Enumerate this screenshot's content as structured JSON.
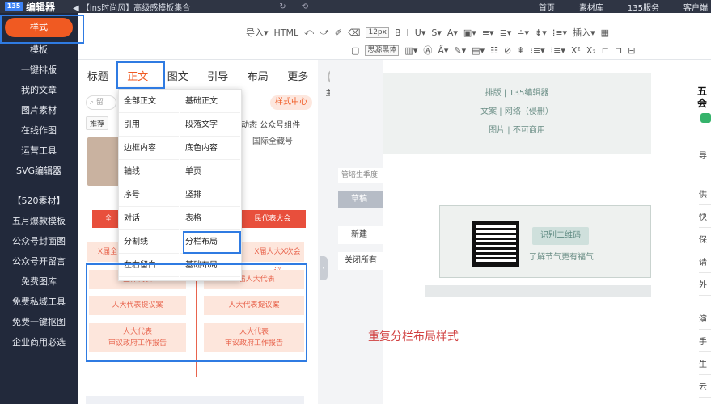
{
  "topbar": {
    "logo": "编辑器",
    "logo_badge": "135",
    "notice": "◀ 【ins时尚风】高级感模板集合",
    "tools": "↻ ⟲",
    "nav": [
      "首页",
      "素材库",
      "135服务",
      "客户端"
    ]
  },
  "sidebar": {
    "active": "样式",
    "items": [
      "模板",
      "一键排版",
      "我的文章",
      "图片素材",
      "在线作图",
      "运营工具",
      "SVG编辑器"
    ],
    "items2": [
      "【520素材】",
      "五月爆款模板",
      "公众号封面图",
      "公众号开留言",
      "免费图库",
      "免费私域工具",
      "免费一键抠图",
      "企业商用必选"
    ]
  },
  "toolbar": {
    "row1": [
      "导入▾",
      "HTML",
      "⤺",
      "⤻",
      "✐",
      "⌫",
      "12px",
      "B",
      "I",
      "U▾",
      "S▾",
      "A▾",
      "▣▾",
      "≡▾",
      "≣▾",
      "≐▾",
      "⇟▾",
      "⁞≡▾",
      "插入▾",
      "▦"
    ],
    "row2": [
      "▢",
      "思源黑体",
      "▥▾",
      "Ⓐ",
      "A̋▾",
      "✎▾",
      "▤▾",
      "☷",
      "⊘",
      "⇞",
      "⁝≡▾",
      "⁞≡▾",
      "X²",
      "X₂",
      "⊏",
      "⊐",
      "⊟"
    ]
  },
  "panel": {
    "tabs": [
      "标题",
      "正文",
      "图文",
      "引导",
      "布局",
      "更多"
    ],
    "active_tab": "正文",
    "theme": "主题色",
    "search_placeholder": "留",
    "style_center": "样式中心",
    "chips": [
      "推荐",
      "SVG",
      "动态"
    ],
    "chip_right": "公众号组件",
    "thumb_text": "国际全藏号",
    "banner_left": "全",
    "banner_right": "民代表大会",
    "cells_left": [
      "X届全",
      "全体代表",
      "人大代表提议案",
      "人大代表\n审议政府工作报告"
    ],
    "cells_right": [
      "X届人大X次会议",
      "X届人大代表",
      "人大代表提议案",
      "人大代表\n审议政府工作报告"
    ]
  },
  "dropdown": {
    "col1": [
      "全部正文",
      "引用",
      "边框内容",
      "轴线",
      "序号",
      "对话",
      "分割线",
      "左右留白"
    ],
    "col2": [
      "基础正文",
      "段落文字",
      "底色内容",
      "单页",
      "竖排",
      "表格",
      "分栏布局",
      "基础布局"
    ]
  },
  "mid": {
    "input": "管培生季度",
    "draft": "草稿",
    "new": "新建",
    "close_all": "关闭所有"
  },
  "canvas": {
    "lines": [
      "排版 | 135编辑器",
      "文案 | 网络（侵删）",
      "图片 | 不可商用"
    ],
    "qr_label": "识别二维码",
    "qr_caption": "了解节气更有福气",
    "repeat_text": "重复分栏布局样式"
  },
  "rightbar": {
    "title": "五 会",
    "items": [
      "导",
      "供",
      "快",
      "保",
      "请",
      "外",
      "演",
      "手",
      "生",
      "云"
    ]
  }
}
